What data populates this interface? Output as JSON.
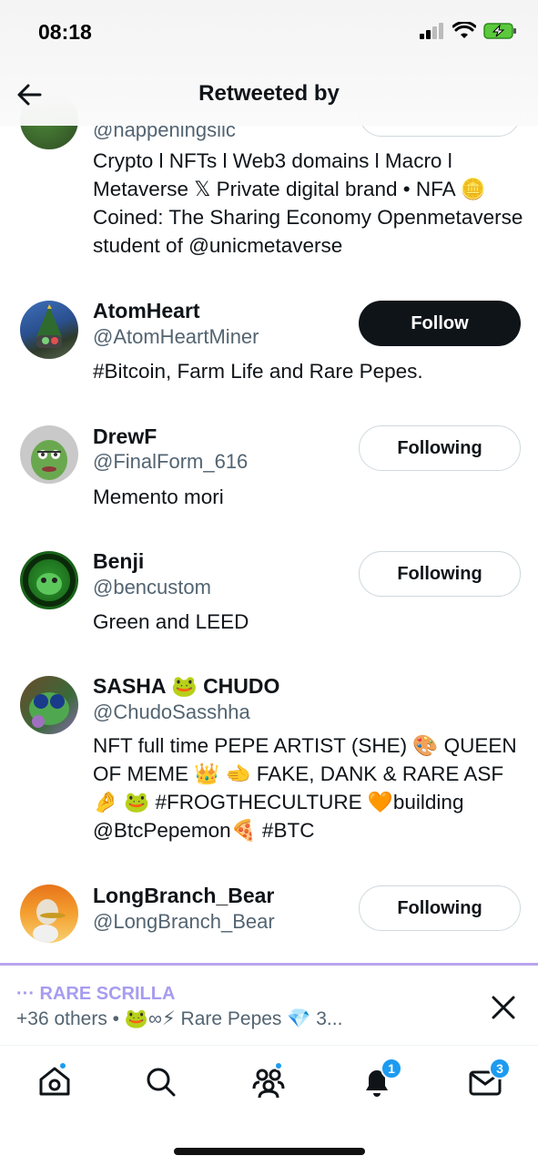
{
  "status_bar": {
    "time": "08:18"
  },
  "header": {
    "title": "Retweeted by"
  },
  "users": [
    {
      "name": "",
      "handle": "@happeningsllc",
      "bio": "Crypto l NFTs l Web3 domains l Macro l Metaverse 𝕏 Private digital brand • NFA 🪙 Coined: The Sharing Economy Openmetaverse student of @unicmetaverse",
      "button": ""
    },
    {
      "name": "AtomHeart",
      "handle": "@AtomHeartMiner",
      "bio": "#Bitcoin, Farm Life and Rare Pepes.",
      "button": "Follow"
    },
    {
      "name": "DrewF",
      "handle": "@FinalForm_616",
      "bio": "Memento mori",
      "button": "Following"
    },
    {
      "name": "Benji",
      "handle": "@bencustom",
      "bio": "Green and LEED",
      "button": "Following"
    },
    {
      "name": "SASHA 🐸 CHUDO",
      "handle": "@ChudoSasshha",
      "bio": "NFT full time PEPE ARTIST (SHE) 🎨 QUEEN OF MEME 👑 🫲 FAKE, DANK & RARE ASF 🤌 🐸 #FROGTHECULTURE 🧡building @BtcPepemon🍕 #BTC",
      "button": "Following"
    },
    {
      "name": "LongBranch_Bear",
      "handle": "@LongBranch_Bear",
      "bio": "",
      "button": "Following"
    }
  ],
  "banner": {
    "title": "··· RARE SCRILLA",
    "subtitle": "+36 others • 🐸∞⚡ Rare Pepes 💎 3..."
  },
  "tabbar": {
    "notifications_badge": "1",
    "messages_badge": "3"
  },
  "colors": {
    "accent": "#1d9bf0",
    "banner_purple": "#a79cf0",
    "follow_button": "#0f1419",
    "secondary_text": "#536471"
  }
}
